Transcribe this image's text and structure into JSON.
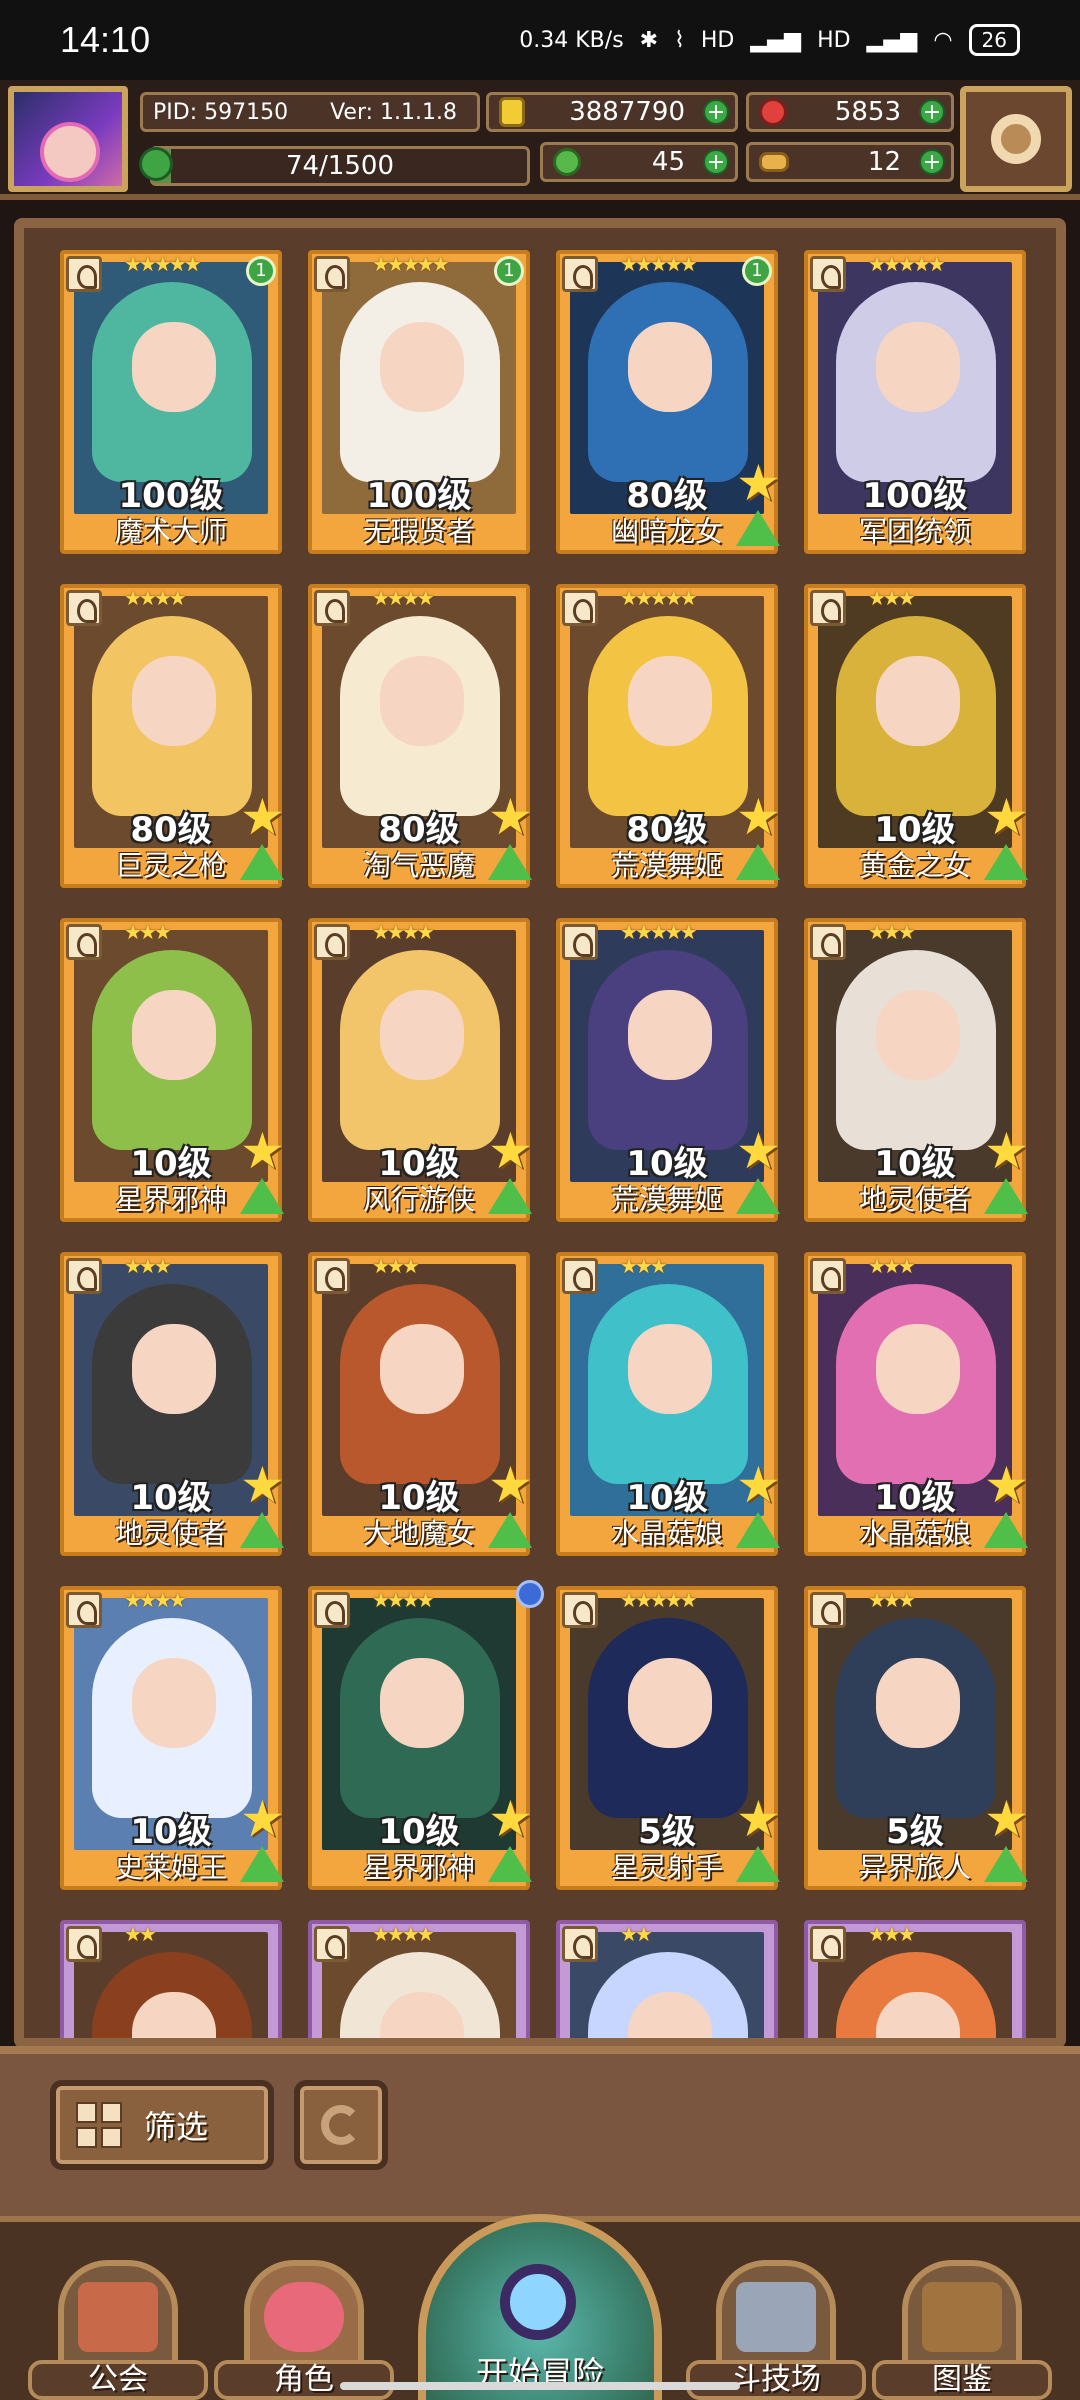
{
  "status_bar": {
    "time": "14:10",
    "net_speed": "0.34 KB/s",
    "net_label_1": "HD",
    "net_label_2": "HD",
    "battery": "26"
  },
  "header": {
    "pid": "PID: 597150",
    "version": "Ver: 1.1.1.8",
    "coins": "3887790",
    "gems": "5853",
    "xp": "74/1500",
    "xp_progress": 0.0493,
    "clover": "45",
    "bone": "12"
  },
  "cards": [
    {
      "level": "100级",
      "name": "魔术大师",
      "stars": "★★★★★",
      "badge": "1",
      "hair": "#4fb7a0",
      "bg": "#2f5b78"
    },
    {
      "level": "100级",
      "name": "无瑕贤者",
      "stars": "★★★★★",
      "badge": "1",
      "hair": "#f3eee6",
      "bg": "#8f6a3b"
    },
    {
      "level": "80级",
      "name": "幽暗龙女",
      "stars": "★★★★★",
      "badge": "1",
      "hair": "#2f6fb3",
      "bg": "#1d3557"
    },
    {
      "level": "100级",
      "name": "军团统领",
      "stars": "★★★★★",
      "badge": "",
      "hair": "#cfcce8",
      "bg": "#3c3660"
    },
    {
      "level": "80级",
      "name": "巨灵之枪",
      "stars": "★★★★",
      "badge": "",
      "hair": "#f2c462",
      "bg": "#6b4a2e"
    },
    {
      "level": "80级",
      "name": "淘气恶魔",
      "stars": "★★★★",
      "badge": "",
      "hair": "#f6ead1",
      "bg": "#6b4a2e"
    },
    {
      "level": "80级",
      "name": "荒漠舞姬",
      "stars": "★★★★★",
      "badge": "",
      "hair": "#f3c443",
      "bg": "#6b4a2e"
    },
    {
      "level": "10级",
      "name": "黄金之女",
      "stars": "★★★",
      "badge": "",
      "hair": "#d8b23a",
      "bg": "#4f3b22"
    },
    {
      "level": "10级",
      "name": "星界邪神",
      "stars": "★★★",
      "badge": "",
      "hair": "#8dbf4a",
      "bg": "#6b4a2e"
    },
    {
      "level": "10级",
      "name": "风行游侠",
      "stars": "★★★★",
      "badge": "",
      "hair": "#f3c56a",
      "bg": "#5a3e2b"
    },
    {
      "level": "10级",
      "name": "荒漠舞姬",
      "stars": "★★★★★",
      "badge": "",
      "hair": "#4a3f7f",
      "bg": "#2f3b5a"
    },
    {
      "level": "10级",
      "name": "地灵使者",
      "stars": "★★★",
      "badge": "",
      "hair": "#e8e0d6",
      "bg": "#4a3a2c"
    },
    {
      "level": "10级",
      "name": "地灵使者",
      "stars": "★★★",
      "badge": "",
      "hair": "#3b3b3b",
      "bg": "#3a4a66"
    },
    {
      "level": "10级",
      "name": "大地魔女",
      "stars": "★★★",
      "badge": "",
      "hair": "#b8582c",
      "bg": "#5a3e2b"
    },
    {
      "level": "10级",
      "name": "水晶菇娘",
      "stars": "★★★",
      "badge": "",
      "hair": "#40c1c9",
      "bg": "#2f6f9a"
    },
    {
      "level": "10级",
      "name": "水晶菇娘",
      "stars": "★★★",
      "badge": "",
      "hair": "#e36fb3",
      "bg": "#4a2f5a"
    },
    {
      "level": "10级",
      "name": "史莱姆王",
      "stars": "★★★★",
      "badge": "",
      "hair": "#e8f0ff",
      "bg": "#5a7fb0"
    },
    {
      "level": "10级",
      "name": "星界邪神",
      "stars": "★★★★",
      "badge": "",
      "hair": "#2f6a55",
      "bg": "#1f3a33"
    },
    {
      "level": "5级",
      "name": "星灵射手",
      "stars": "★★★★★",
      "badge": "",
      "hair": "#1e2a5a",
      "bg": "#4a3a2c"
    },
    {
      "level": "5级",
      "name": "异界旅人",
      "stars": "★★★",
      "badge": "",
      "hair": "#2f3f5a",
      "bg": "#4a3a2c"
    },
    {
      "level": "",
      "name": "",
      "stars": "★★",
      "badge": "",
      "hair": "#8a3f1f",
      "bg": "#5a3e2b"
    },
    {
      "level": "",
      "name": "",
      "stars": "★★★★",
      "badge": "",
      "hair": "#f1e6d6",
      "bg": "#6b4a2e"
    },
    {
      "level": "",
      "name": "",
      "stars": "★★",
      "badge": "",
      "hair": "#c6d6ff",
      "bg": "#3a4a66"
    },
    {
      "level": "",
      "name": "",
      "stars": "★★★",
      "badge": "",
      "hair": "#e87a3f",
      "bg": "#5a3e2b"
    }
  ],
  "filter": {
    "filter_label": "筛选"
  },
  "nav": {
    "guild": "公会",
    "character": "角色",
    "start": "开始冒险",
    "arena": "斗技场",
    "codex": "图鉴"
  }
}
